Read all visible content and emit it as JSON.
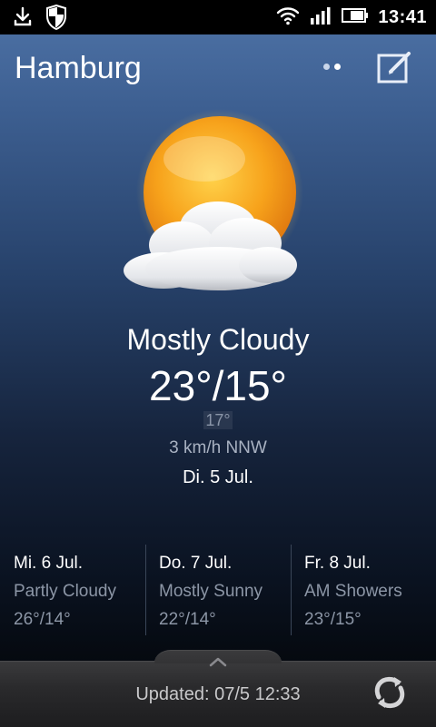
{
  "status_bar": {
    "time": "13:41",
    "icons": [
      "download-icon",
      "shield-icon",
      "wifi-icon",
      "signal-icon",
      "battery-icon"
    ]
  },
  "header": {
    "city": "Hamburg",
    "page_dots": 2,
    "active_dot": 2,
    "edit_icon": "edit-icon"
  },
  "current": {
    "icon": "sun-behind-cloud-icon",
    "condition": "Mostly Cloudy",
    "high_low": "23°/15°",
    "feels_like": "17°",
    "wind": "3 km/h NNW",
    "date": "Di. 5 Jul."
  },
  "forecast": [
    {
      "day": "Mi. 6 Jul.",
      "condition": "Partly Cloudy",
      "temps": "26°/14°"
    },
    {
      "day": "Do. 7 Jul.",
      "condition": "Mostly Sunny",
      "temps": "22°/14°"
    },
    {
      "day": "Fr. 8 Jul.",
      "condition": "AM Showers",
      "temps": "23°/15°"
    }
  ],
  "footer": {
    "updated": "Updated: 07/5 12:33",
    "refresh_icon": "refresh-icon"
  },
  "colors": {
    "accent_sun": "#f7a21b",
    "background_top": "#4f74a8",
    "background_bottom": "#05090f"
  }
}
